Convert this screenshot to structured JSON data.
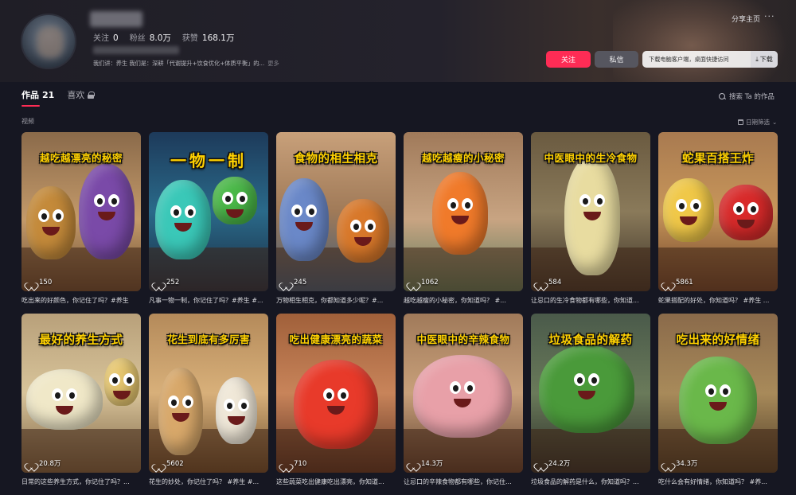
{
  "profile": {
    "stats": [
      {
        "label": "关注",
        "value": "0"
      },
      {
        "label": "粉丝",
        "value": "8.0万"
      },
      {
        "label": "获赞",
        "value": "168.1万"
      }
    ],
    "bio": "我们讲：养生 我们是：深耕「代谢提升+饮食优化+体质平衡」的...",
    "bio_more": "更多"
  },
  "header": {
    "share_label": "分享主页",
    "more_label": "···",
    "follow_label": "关注",
    "message_label": "私信",
    "download_text": "下载电脑客户端，桌面快捷访问",
    "download_button": "下载"
  },
  "tabs": [
    {
      "label": "作品",
      "count": "21"
    },
    {
      "label": "喜欢",
      "count": ""
    }
  ],
  "search_label": "搜索 Ta 的作品",
  "section_label": "视频",
  "date_filter_label": "日期筛选",
  "videos": [
    {
      "overlay": "越吃越漂亮的秘密",
      "likes": "150",
      "title": "吃出来的好颜色，你记住了吗？#养生"
    },
    {
      "overlay": "一物一制",
      "likes": "252",
      "title": "凡事一物一制，你记住了吗？#养生 #..."
    },
    {
      "overlay": "食物的相生相克",
      "likes": "245",
      "title": "万物相生相克，你都知道多少呢？#..."
    },
    {
      "overlay": "越吃越瘦的小秘密",
      "likes": "1062",
      "title": "越吃越瘦的小秘密，你知道吗？ #..."
    },
    {
      "overlay": "中医眼中的生冷食物",
      "likes": "584",
      "title": "让忌口的生冷食物都有哪些，你知道..."
    },
    {
      "overlay": "蛇果百搭王炸",
      "likes": "5861",
      "title": "蛇果搭配的好处，你知道吗？ #养生 ..."
    },
    {
      "overlay": "最好的养生方式",
      "likes": "20.8万",
      "title": "日常的这些养生方式，你记住了吗？..."
    },
    {
      "overlay": "花生到底有多厉害",
      "likes": "5602",
      "title": "花生的妙处，你记住了吗？ #养生 #..."
    },
    {
      "overlay": "吃出健康漂亮的蔬菜",
      "likes": "710",
      "title": "这些蔬菜吃出健康吃出漂亮，你知道..."
    },
    {
      "overlay": "中医眼中的辛辣食物",
      "likes": "14.3万",
      "title": "让忌口的辛辣食物都有哪些，你记住..."
    },
    {
      "overlay": "垃圾食品的解药",
      "likes": "24.2万",
      "title": "垃圾食品的解药是什么，你知道吗？..."
    },
    {
      "overlay": "吃出来的好情绪",
      "likes": "34.3万",
      "title": "吃什么会有好情绪，你知道吗？ #养..."
    }
  ]
}
